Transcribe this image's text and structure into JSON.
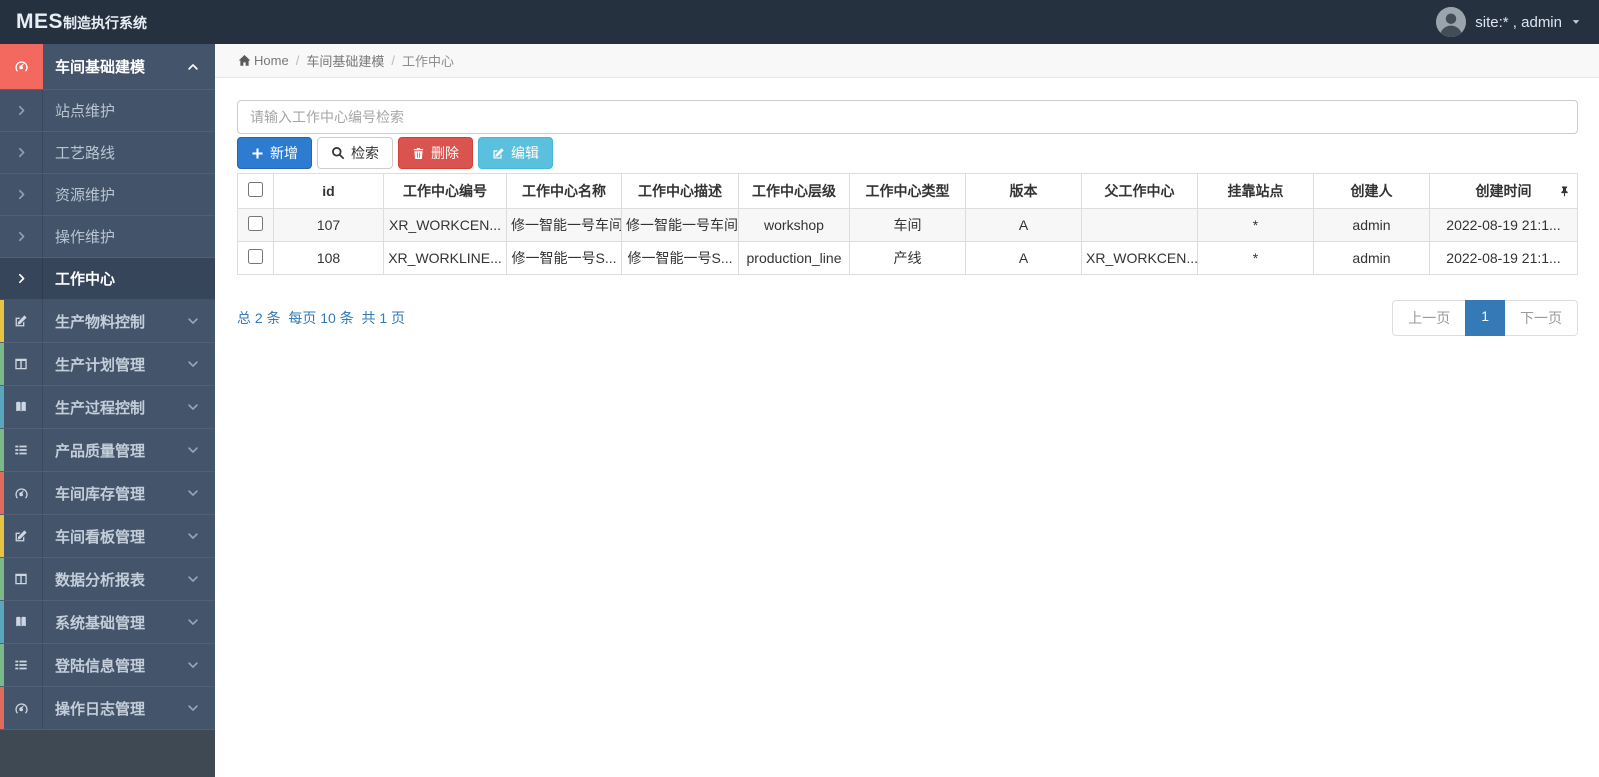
{
  "colors": {
    "accent_red": "#f4695f",
    "primary_blue": "#2d7cd1",
    "danger_red": "#d9534f",
    "info_blue": "#5bc0de",
    "link_blue": "#337ab7",
    "pagination_active": "#337ab7"
  },
  "navbar": {
    "logo_bold": "MES",
    "logo_text": "制造执行系统",
    "user_label": "site:* , admin"
  },
  "sidebar": {
    "active_group": {
      "label": "车间基础建模",
      "icon": "gauge"
    },
    "sub_items": [
      {
        "label": "站点维护",
        "active": false
      },
      {
        "label": "工艺路线",
        "active": false
      },
      {
        "label": "资源维护",
        "active": false
      },
      {
        "label": "操作维护",
        "active": false
      },
      {
        "label": "工作中心",
        "active": true
      }
    ],
    "groups": [
      {
        "label": "生产物料控制",
        "icon": "pencil-square",
        "strip": "#e4c441"
      },
      {
        "label": "生产计划管理",
        "icon": "columns",
        "strip": "#7cb98a"
      },
      {
        "label": "生产过程控制",
        "icon": "book",
        "strip": "#5aa7bd"
      },
      {
        "label": "产品质量管理",
        "icon": "list",
        "strip": "#7cb98a"
      },
      {
        "label": "车间库存管理",
        "icon": "gauge",
        "strip": "#e06b5d"
      },
      {
        "label": "车间看板管理",
        "icon": "pencil-square",
        "strip": "#e4c441"
      },
      {
        "label": "数据分析报表",
        "icon": "columns",
        "strip": "#7cb98a"
      },
      {
        "label": "系统基础管理",
        "icon": "book",
        "strip": "#5aa7bd"
      },
      {
        "label": "登陆信息管理",
        "icon": "list",
        "strip": "#7cb98a"
      },
      {
        "label": "操作日志管理",
        "icon": "gauge",
        "strip": "#e06b5d"
      }
    ]
  },
  "breadcrumb": {
    "items": [
      "Home",
      "车间基础建模",
      "工作中心"
    ]
  },
  "toolbar": {
    "search_placeholder": "请输入工作中心编号检索",
    "buttons": [
      {
        "label": "新增",
        "icon": "plus",
        "style": "primary"
      },
      {
        "label": "检索",
        "icon": "search",
        "style": "default"
      },
      {
        "label": "删除",
        "icon": "trash",
        "style": "danger"
      },
      {
        "label": "编辑",
        "icon": "edit",
        "style": "info"
      }
    ]
  },
  "table": {
    "columns": [
      "id",
      "工作中心编号",
      "工作中心名称",
      "工作中心描述",
      "工作中心层级",
      "工作中心类型",
      "版本",
      "父工作中心",
      "挂靠站点",
      "创建人",
      "创建时间"
    ],
    "rows": [
      [
        "107",
        "XR_WORKCEN...",
        "修一智能一号车间",
        "修一智能一号车间",
        "workshop",
        "车间",
        "A",
        "",
        "*",
        "admin",
        "2022-08-19 21:1..."
      ],
      [
        "108",
        "XR_WORKLINE...",
        "修一智能一号S...",
        "修一智能一号S...",
        "production_line",
        "产线",
        "A",
        "XR_WORKCEN...",
        "*",
        "admin",
        "2022-08-19 21:1..."
      ]
    ]
  },
  "pagination": {
    "summary": "总 2 条  每页 10 条  共 1 页",
    "prev_label": "上一页",
    "current_page": "1",
    "next_label": "下一页"
  }
}
